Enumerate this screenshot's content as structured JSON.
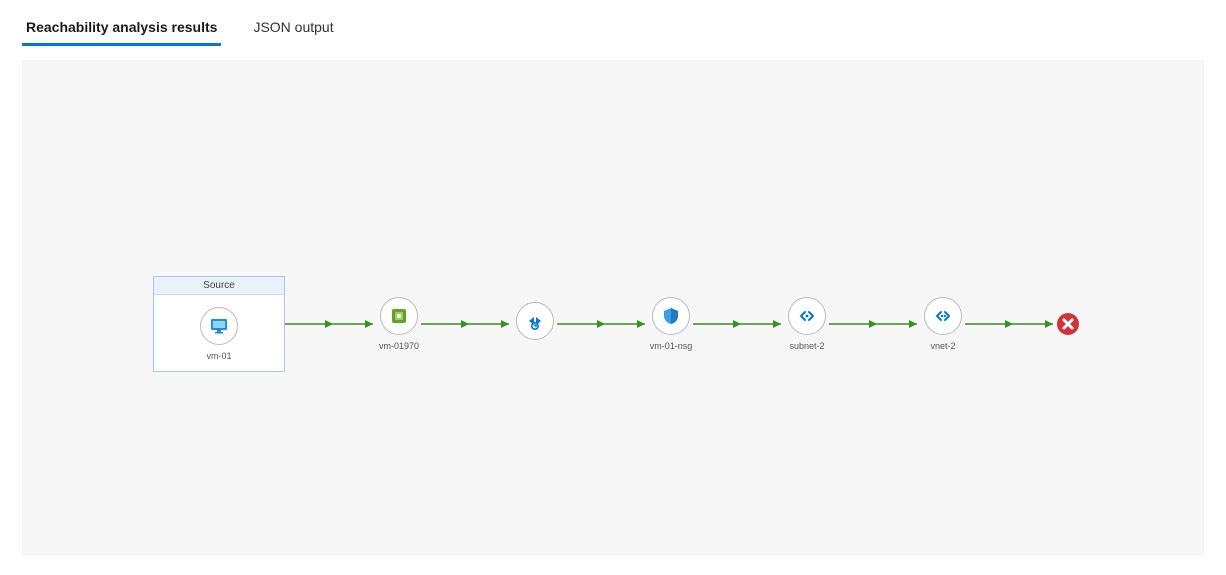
{
  "tabs": {
    "reachability": "Reachability analysis results",
    "json": "JSON output"
  },
  "diagram": {
    "sourceBox": {
      "header": "Source",
      "label": "vm-01"
    },
    "hops": [
      {
        "label": "vm-01970",
        "icon": "nic"
      },
      {
        "label": "",
        "icon": "ipconfig"
      },
      {
        "label": "vm-01-nsg",
        "icon": "nsg"
      },
      {
        "label": "subnet-2",
        "icon": "subnet"
      },
      {
        "label": "vnet-2",
        "icon": "vnet"
      }
    ],
    "terminal": "fail"
  },
  "colors": {
    "arrow": "#3a8f1e",
    "fail": "#d13438",
    "tabAccent": "#0078d4"
  }
}
